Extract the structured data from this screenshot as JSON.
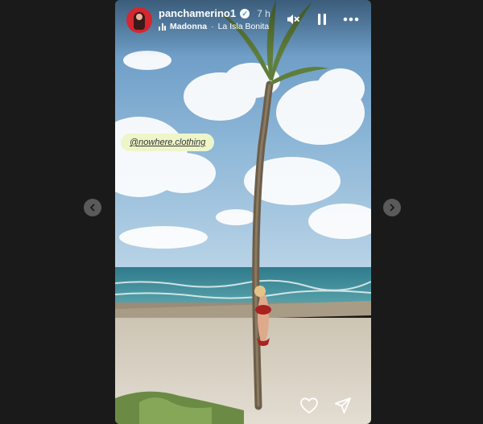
{
  "story": {
    "username": "panchamerino1",
    "time": "7 h",
    "song": {
      "artist": "Madonna",
      "separator": "·",
      "title": "La Isla Bonita"
    },
    "mention": "@nowhere.clothing"
  },
  "icons": {
    "verified": "verified-badge-icon",
    "mute": "speaker-muted-icon",
    "pause": "pause-icon",
    "more": "more-horizontal-icon",
    "like": "heart-icon",
    "share": "send-icon",
    "prev": "chevron-left-icon",
    "next": "chevron-right-icon",
    "music": "music-bars-icon"
  },
  "colors": {
    "background": "#1a1a1a",
    "avatar": "#d6262f",
    "verified": "#1d9bf0",
    "mention_bg": "#eef6c9",
    "nav_button": "#5a5a5a"
  }
}
